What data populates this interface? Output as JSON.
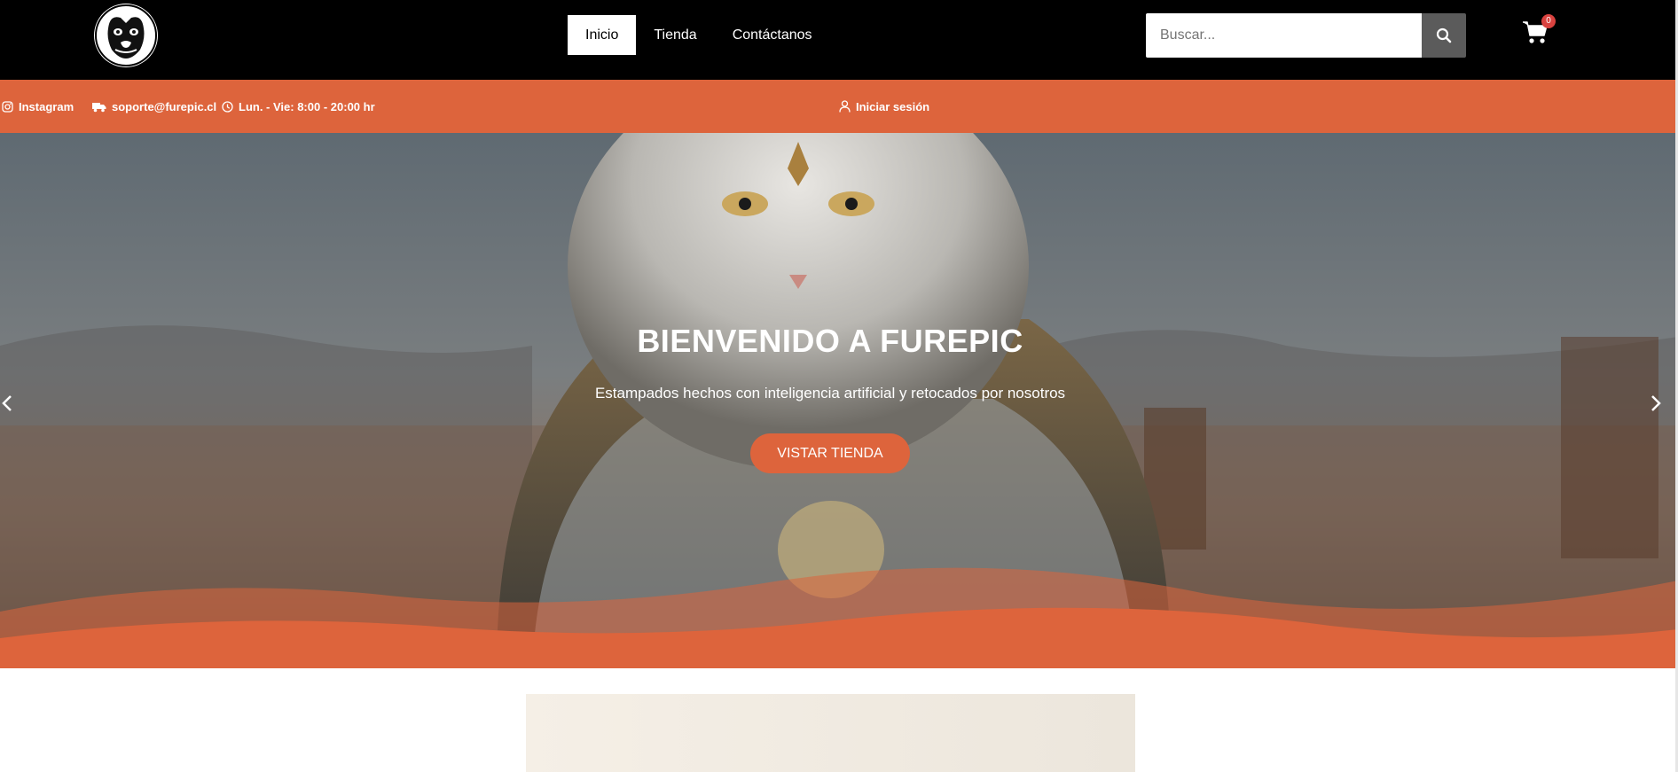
{
  "header": {
    "logo_alt": "bulldog-logo",
    "nav": [
      {
        "label": "Inicio",
        "active": true
      },
      {
        "label": "Tienda",
        "active": false
      },
      {
        "label": "Contáctanos",
        "active": false
      }
    ],
    "search_placeholder": "Buscar...",
    "cart_count": "0"
  },
  "infobar": {
    "instagram": "Instagram",
    "email": "soporte@furepic.cl",
    "hours": "Lun. - Vie: 8:00 - 20:00 hr",
    "login": "Iniciar sesión"
  },
  "hero": {
    "title": "BIENVENIDO A FUREPIC",
    "subtitle": "Estampados hechos con inteligencia artificial y retocados por nosotros",
    "button": "VISTAR TIENDA"
  },
  "colors": {
    "accent": "#dd643c",
    "topbar": "#000000",
    "search_button": "#5b5b5b",
    "badge": "#d9423f"
  }
}
